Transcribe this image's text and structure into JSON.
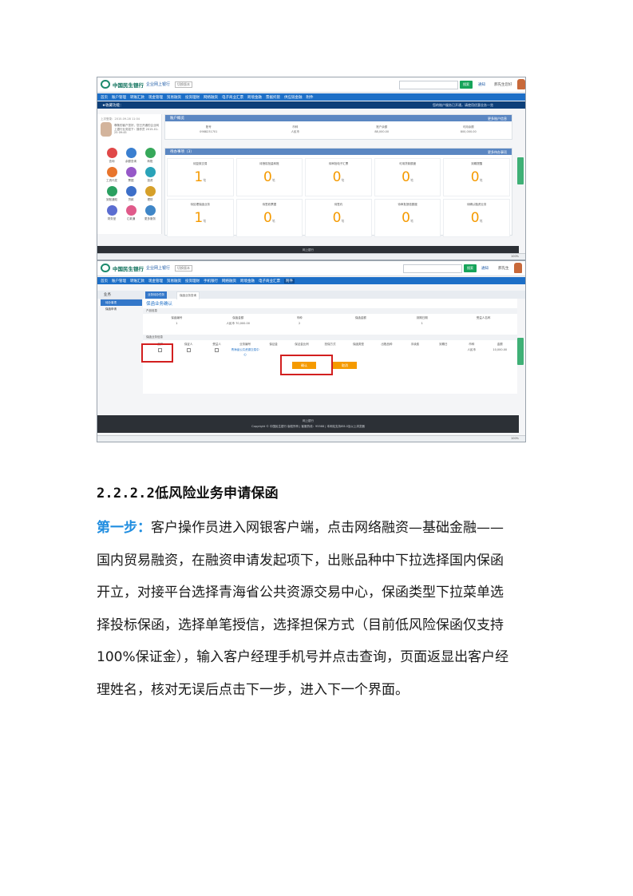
{
  "shot1": {
    "logo": {
      "name": "中国民生银行",
      "sub": "企业网上银行",
      "badge": "切换版本"
    },
    "search_button": "搜索",
    "header_note": "通知",
    "user": "郝先生您好",
    "nav": [
      "首页",
      "账户管理",
      "转账汇款",
      "现金管理",
      "贸易融资",
      "投资理财",
      "网络融资",
      "电子商业汇票",
      "跨境金融",
      "票据托管",
      "供应链金融",
      "附件"
    ],
    "subnav_left": "★收藏功能：",
    "subnav_right": "您的账户服务已开通，请使用优惠业务一览",
    "profile_head": "上次登录：2015-09-28 11:04",
    "profile_text": "尊敬的客户您好，您已开通的企业网上银行业务如下：操作员 2015-01-25 09:45",
    "quick_icons": [
      "查询",
      "余额查询",
      "转账",
      "工资代发",
      "票据",
      "投资",
      "到账通知",
      "贷款",
      "理财",
      "财务室",
      "汇款通",
      "更多服务"
    ],
    "account_panel": {
      "title": "账户概览",
      "more": "更多账户信息",
      "headers": [
        "账号",
        "币种",
        "账户余额",
        "可用余额"
      ],
      "values": [
        "0988231701",
        "人民币",
        "88,000.00",
        "800,000.00"
      ]
    },
    "stats_panel": {
      "title": "待办事项（3）",
      "more": "更多待办事项",
      "items": [
        {
          "label": "待复核交易",
          "value": "1",
          "unit": "笔"
        },
        {
          "label": "待授权批量转账",
          "value": "0",
          "unit": "笔"
        },
        {
          "label": "待审批电子汇票",
          "value": "0",
          "unit": "笔"
        },
        {
          "label": "可用贷款额度",
          "value": "0",
          "unit": "笔"
        },
        {
          "label": "到期提醒",
          "value": "0",
          "unit": "笔"
        },
        {
          "label": "待处理保函业务",
          "value": "1",
          "unit": "笔"
        },
        {
          "label": "待签收票据",
          "value": "0",
          "unit": "笔"
        },
        {
          "label": "待签约",
          "value": "0",
          "unit": "笔"
        },
        {
          "label": "待审批授信额度",
          "value": "0",
          "unit": "笔"
        },
        {
          "label": "待确认融资业务",
          "value": "0",
          "unit": "笔"
        }
      ]
    },
    "footer": "网上银行",
    "side_tab": "在线客服",
    "status_right": "100%"
  },
  "shot2": {
    "logo": {
      "name": "中国民生银行",
      "sub": "企业网上银行",
      "badge": "切换版本"
    },
    "search_button": "搜索",
    "header_note": "通知",
    "user": "郝先生",
    "nav": [
      "首页",
      "账户管理",
      "转账汇款",
      "现金管理",
      "贸易融资",
      "投资理财",
      "手机银行",
      "网络融资",
      "跨境金融",
      "电子商业汇票",
      "附件"
    ],
    "left_nav": {
      "head": "业务",
      "items": [
        "待办事项",
        "保函申请"
      ]
    },
    "tabs": [
      "业务待办任务",
      "保函业务查询"
    ],
    "title": "保函业务确认",
    "sect1": "产品信息",
    "sect2": "保函业务信息",
    "row1_headers": [
      "保函编号",
      "保函金额",
      "币种",
      "保函金额",
      "到期日期",
      "受益人名称"
    ],
    "row1_values": [
      "1",
      "人民币 70,000.00",
      "2",
      "",
      "1",
      ""
    ],
    "row2_headers": [
      "选择",
      "保证人",
      "受益人",
      "业务编号",
      "保证金",
      "保证金比例",
      "担保方式",
      "保函类型",
      "出账品种",
      "手续费",
      "到期日",
      "币种",
      "金额"
    ],
    "row2_values": [
      "",
      "",
      "",
      "青海省公共资源交易中心",
      "",
      "",
      "",
      "",
      "",
      "",
      "",
      "人民币",
      "10,000.00"
    ],
    "buttons": {
      "confirm": "确认",
      "cancel": "取消"
    },
    "footer_title": "网上银行",
    "footer_text": "Copyright © 中国民生银行 版权所有 | 客服热线：95568 | 本网站支持IE8.0及以上浏览器",
    "side_tab": "在线客服",
    "status_right": "100%"
  },
  "heading": "2.2.2.2低风险业务申请保函",
  "step_label": "第一步：",
  "paragraph_lines": [
    "客户操作员进入网银客户端，点击网络融资—基础金融——",
    "国内贸易融资，在融资申请发起项下，出账品种中下拉选择国内保函",
    "开立，对接平台选择青海省公共资源交易中心，保函类型下拉菜单选",
    "择投标保函，选择单笔授信，选择担保方式（目前低风险保函仅支持",
    "100%保证金），输入客户经理手机号并点击查询，页面返显出客户经",
    "理姓名，核对无误后点击下一步，进入下一个界面。"
  ]
}
